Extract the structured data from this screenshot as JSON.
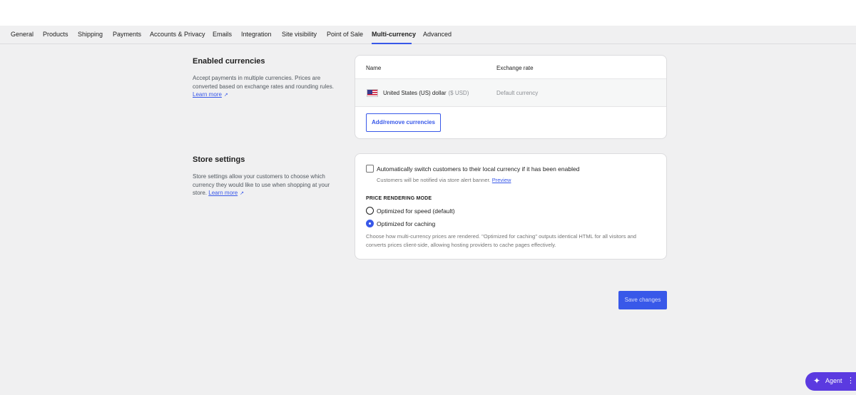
{
  "tabs": [
    {
      "label": "General"
    },
    {
      "label": "Products"
    },
    {
      "label": "Shipping"
    },
    {
      "label": "Payments"
    },
    {
      "label": "Accounts & Privacy"
    },
    {
      "label": "Emails"
    },
    {
      "label": "Integration"
    },
    {
      "label": "Site visibility"
    },
    {
      "label": "Point of Sale"
    },
    {
      "label": "Multi-currency",
      "active": true
    },
    {
      "label": "Advanced"
    }
  ],
  "enabled_currencies": {
    "title": "Enabled currencies",
    "description": "Accept payments in multiple currencies. Prices are converted based on exchange rates and rounding rules.",
    "learn_more": "Learn more",
    "table": {
      "headers": {
        "name": "Name",
        "exchange_rate": "Exchange rate"
      },
      "rows": [
        {
          "flag_icon": "us-flag-icon",
          "name": "United States (US) dollar",
          "code": "($ USD)",
          "exchange_rate": "Default currency"
        }
      ]
    },
    "add_remove_label": "Add/remove currencies"
  },
  "store_settings": {
    "title": "Store settings",
    "description": "Store settings allow your customers to choose which currency they would like to use when shopping at your store.",
    "learn_more": "Learn more",
    "auto_switch": {
      "label": "Automatically switch customers to their local currency if it has been enabled",
      "checked": false,
      "help": "Customers will be notified via store alert banner.",
      "preview_link": "Preview"
    },
    "price_rendering": {
      "heading": "PRICE RENDERING MODE",
      "options": [
        {
          "label": "Optimized for speed (default)",
          "checked": false
        },
        {
          "label": "Optimized for caching",
          "checked": true
        }
      ],
      "help": "Choose how multi-currency prices are rendered. \"Optimized for caching\" outputs identical HTML for all visitors and converts prices client-side, allowing hosting providers to cache pages effectively."
    }
  },
  "save_label": "Save changes",
  "agent": {
    "label": "Agent",
    "icon": "sparkle-icon",
    "grip_icon": "drag-handle-icon"
  },
  "colors": {
    "accent": "#3858e9",
    "agent": "#5b3ae0",
    "background": "#f0f0f1"
  }
}
